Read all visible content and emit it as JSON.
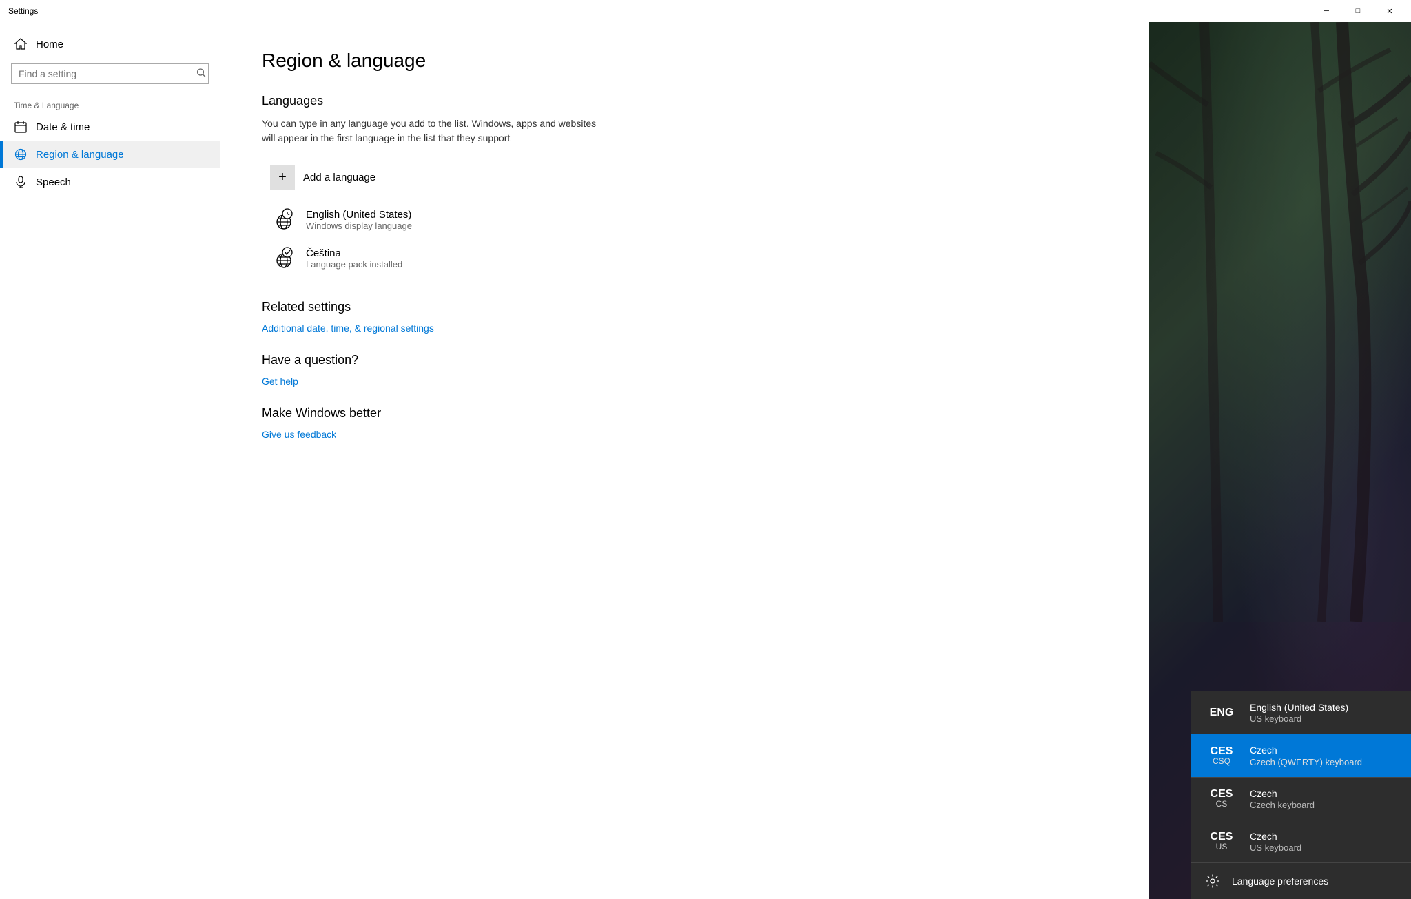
{
  "window": {
    "title": "Settings",
    "controls": {
      "minimize": "─",
      "maximize": "□",
      "close": "✕"
    }
  },
  "sidebar": {
    "home_label": "Home",
    "search_placeholder": "Find a setting",
    "section_label": "Time & Language",
    "items": [
      {
        "id": "date-time",
        "label": "Date & time",
        "icon": "calendar"
      },
      {
        "id": "region-language",
        "label": "Region & language",
        "icon": "globe",
        "active": true
      },
      {
        "id": "speech",
        "label": "Speech",
        "icon": "microphone"
      }
    ]
  },
  "main": {
    "page_title": "Region & language",
    "languages_section": {
      "title": "Languages",
      "description": "You can type in any language you add to the list. Windows, apps and websites will appear in the first language in the list that they support",
      "add_label": "Add a language",
      "languages": [
        {
          "name": "English (United States)",
          "sub": "Windows display language"
        },
        {
          "name": "Čeština",
          "sub": "Language pack installed"
        }
      ]
    },
    "related_settings": {
      "title": "Related settings",
      "link": "Additional date, time, & regional settings"
    },
    "help": {
      "title": "Have a question?",
      "link": "Get help"
    },
    "feedback": {
      "title": "Make Windows better",
      "link": "Give us feedback"
    }
  },
  "lang_popup": {
    "items": [
      {
        "code_main": "ENG",
        "code_sub": "",
        "name": "English (United States)",
        "keyboard": "US keyboard",
        "selected": false
      },
      {
        "code_main": "CES",
        "code_sub": "CSQ",
        "name": "Czech",
        "keyboard": "Czech (QWERTY) keyboard",
        "selected": true
      },
      {
        "code_main": "CES",
        "code_sub": "CS",
        "name": "Czech",
        "keyboard": "Czech keyboard",
        "selected": false
      },
      {
        "code_main": "CES",
        "code_sub": "US",
        "name": "Czech",
        "keyboard": "US keyboard",
        "selected": false
      }
    ],
    "prefs_label": "Language preferences"
  }
}
